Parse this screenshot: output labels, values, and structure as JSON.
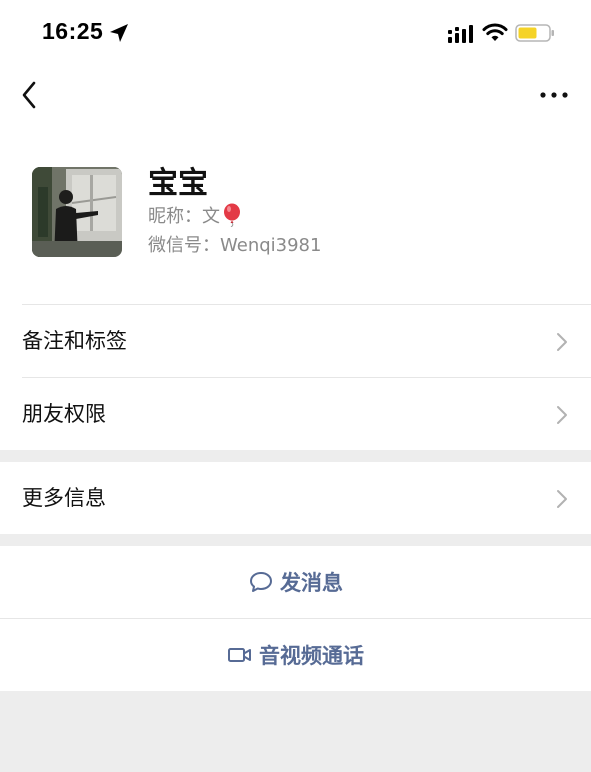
{
  "status_bar": {
    "time": "16:25",
    "location_icon": "location-arrow-icon",
    "signal_icon": "cellular-signal-icon",
    "wifi_icon": "wifi-icon",
    "battery_icon": "battery-icon",
    "battery_color": "#f5d327"
  },
  "nav": {
    "back_icon": "chevron-left-icon",
    "more_icon": "more-dots-icon"
  },
  "profile": {
    "name": "宝宝",
    "nickname_label": "昵称：文",
    "nickname_emoji": "balloon-icon",
    "wechat_id_label": "微信号：Wenqi3981"
  },
  "rows": [
    {
      "label": "备注和标签"
    },
    {
      "label": "朋友权限"
    },
    {
      "label": "更多信息"
    }
  ],
  "actions": {
    "message": {
      "label": "发消息",
      "icon": "chat-bubble-icon"
    },
    "video_call": {
      "label": "音视频通话",
      "icon": "video-camera-icon"
    }
  },
  "colors": {
    "accent": "#576b95",
    "background": "#ededed",
    "secondary_text": "#8a8a8a"
  }
}
